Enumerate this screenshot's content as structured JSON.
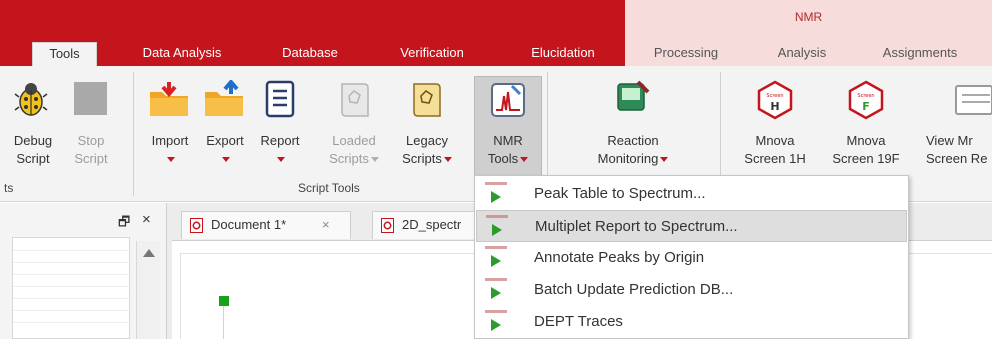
{
  "tabs": {
    "context_title": "NMR",
    "items": [
      {
        "label": "Tools"
      },
      {
        "label": "Data Analysis"
      },
      {
        "label": "Database"
      },
      {
        "label": "Verification"
      },
      {
        "label": "Elucidation"
      },
      {
        "label": "Processing"
      },
      {
        "label": "Analysis"
      },
      {
        "label": "Assignments"
      }
    ]
  },
  "ribbon": {
    "debug": {
      "line1": "Debug",
      "line2": "Script"
    },
    "stop": {
      "line1": "Stop",
      "line2": "Script"
    },
    "import": {
      "label": "Import"
    },
    "export": {
      "label": "Export"
    },
    "report": {
      "label": "Report"
    },
    "loaded": {
      "line1": "Loaded",
      "line2": "Scripts"
    },
    "legacy": {
      "line1": "Legacy",
      "line2": "Scripts"
    },
    "nmr_tools": {
      "line1": "NMR",
      "line2": "Tools"
    },
    "reaction": {
      "line1": "Reaction",
      "line2": "Monitoring"
    },
    "mnova_1h": {
      "line1": "Mnova",
      "line2": "Screen 1H"
    },
    "mnova_19f": {
      "line1": "Mnova",
      "line2": "Screen 19F"
    },
    "view_mn": {
      "line1": "View Mr",
      "line2": "Screen Re"
    },
    "group_left_partial": "ts",
    "group_script_tools": "Script Tools"
  },
  "documents": {
    "tabs": [
      {
        "label": "Document 1*",
        "close": "×"
      },
      {
        "label": "2D_spectr"
      }
    ],
    "pane_controls": {
      "restore": "🗗",
      "close": "×"
    }
  },
  "nmr_tools_menu": {
    "items": [
      {
        "label": "Peak Table to Spectrum...",
        "hover": false
      },
      {
        "label": "Multiplet Report to Spectrum...",
        "hover": true
      },
      {
        "label": "Annotate Peaks by Origin",
        "hover": false
      },
      {
        "label": "Batch Update Prediction DB...",
        "hover": false
      },
      {
        "label": "DEPT Traces",
        "hover": false
      }
    ]
  },
  "colors": {
    "brand_red": "#c4151c",
    "context_tab_bg": "#f7dcdc",
    "ribbon_bg": "#f3f3f3",
    "menu_hover": "#dedede",
    "run_green": "#2e9a2e"
  },
  "icons": [
    "bug-icon",
    "stop-icon",
    "import-folder-icon",
    "export-folder-icon",
    "report-icon",
    "loaded-scripts-icon",
    "legacy-scripts-icon",
    "nmr-tools-icon",
    "reaction-monitoring-icon",
    "mnova-screen-1h-icon",
    "mnova-screen-19f-icon",
    "view-screen-report-icon",
    "play-icon"
  ]
}
